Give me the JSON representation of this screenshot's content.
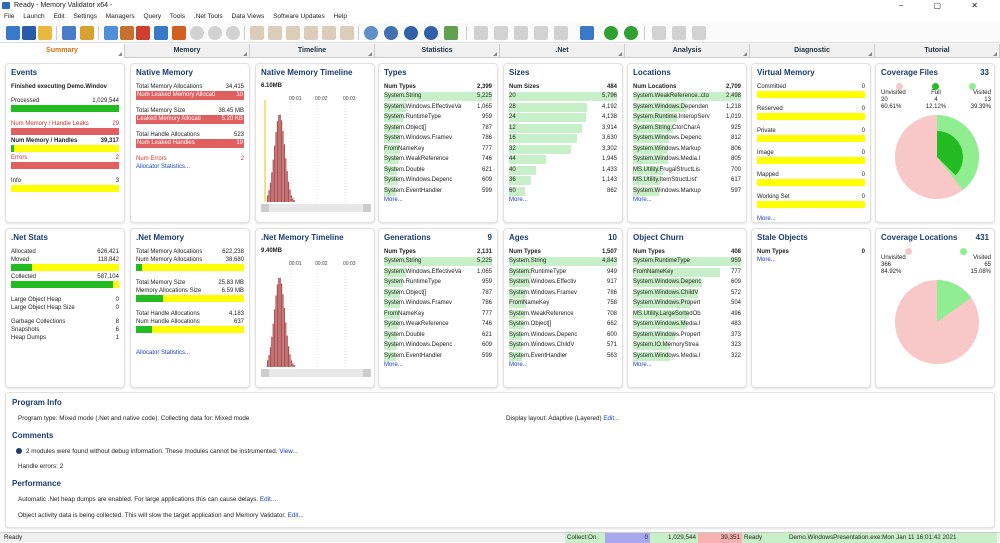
{
  "window": {
    "title": "Ready - Memory Validator x64 -",
    "controls": "–  ▢  ✕"
  },
  "menu": [
    "File",
    "Launch",
    "Edit",
    "Settings",
    "Managers",
    "Query",
    "Tools",
    ".Net Tools",
    "Data Views",
    "Software Updates",
    "Help"
  ],
  "tabs": [
    "Summary",
    "Memory",
    "Timeline",
    "Statistics",
    ".Net",
    "Analysis",
    "Diagnostic",
    "Tutorial"
  ],
  "colors": {
    "accent": "#d07010",
    "title": "#1a3d6e",
    "green": "#22bb22",
    "yellow": "#ffff00",
    "red": "#e06060",
    "lightgreen": "#c8f0c8",
    "pink": "#f8c8c8"
  },
  "events": {
    "title": "Events",
    "subtitle": "Finished executing Demo.Windov",
    "processed_label": "Processed",
    "processed": "1,029,544",
    "leaks_label": "Num Memory / Handle Leaks",
    "leaks": "29",
    "handles_label": "Num Memory / Handles",
    "handles": "39,317",
    "errors_label": "Errors",
    "errors": "2",
    "info_label": "Info",
    "info": "3"
  },
  "native_memory": {
    "title": "Native Memory",
    "total_alloc_label": "Total Memory Allocations",
    "total_alloc": "34,415",
    "leaked_alloc_label": "Num Leaked Memory Allocati",
    "leaked_alloc": "10",
    "total_size_label": "Total Memory Size",
    "total_size": "38.45 MB",
    "leaked_size_label": "Leaked Memory Allocati",
    "leaked_size": "5.20 KB",
    "handle_alloc_label": "Total Handle Allocations",
    "handle_alloc": "523",
    "leaked_handles_label": "Num Leaked Handles",
    "leaked_handles": "19",
    "errors_label": "Num Errors",
    "errors": "2",
    "link": "Allocator Statistics..."
  },
  "native_timeline": {
    "title": "Native Memory Timeline",
    "value": "6.10MB",
    "ticks": [
      "00:01",
      "00:02",
      "00:03"
    ]
  },
  "types": {
    "title": "Types",
    "header_name": "Num Types",
    "header_value": "2,399",
    "more": "More...",
    "rows": [
      [
        "System.String",
        "5,225",
        1
      ],
      [
        "System.Windows.EffectiveVa",
        "1,065",
        0.2
      ],
      [
        "System.RuntimeType",
        "959",
        0.18
      ],
      [
        "System.Object[]",
        "787",
        0.15
      ],
      [
        "System.Windows.Framev",
        "786",
        0.15
      ],
      [
        "FromNameKey",
        "777",
        0.15
      ],
      [
        "System.WeakReference",
        "746",
        0.14
      ],
      [
        "System.Double",
        "621",
        0.12
      ],
      [
        "System.Windows.Depenc",
        "609",
        0.12
      ],
      [
        "System.EventHandler",
        "599",
        0.11
      ]
    ]
  },
  "sizes": {
    "title": "Sizes",
    "header_name": "Num Sizes",
    "header_value": "484",
    "more": "More...",
    "rows": [
      [
        "20",
        "5,796",
        1
      ],
      [
        "28",
        "4,192",
        0.72
      ],
      [
        "24",
        "4,138",
        0.71
      ],
      [
        "12",
        "3,914",
        0.68
      ],
      [
        "16",
        "3,630",
        0.63
      ],
      [
        "32",
        "3,302",
        0.57
      ],
      [
        "44",
        "1,945",
        0.34
      ],
      [
        "40",
        "1,433",
        0.25
      ],
      [
        "36",
        "1,143",
        0.2
      ],
      [
        "60",
        "862",
        0.15
      ]
    ]
  },
  "locations": {
    "title": "Locations",
    "header_name": "Num Locations",
    "header_value": "2,709",
    "more": "More...",
    "rows": [
      [
        "System.WeakReference..cto",
        "2,498",
        1
      ],
      [
        "System.Windows.Dependen",
        "1,218",
        0.49
      ],
      [
        "System.Runtime.InteropServ",
        "1,019",
        0.41
      ],
      [
        "System.String.CtorCharA",
        "925",
        0.37
      ],
      [
        "System.Windows.Depenc",
        "812",
        0.33
      ],
      [
        "System.Windows.Markup",
        "806",
        0.32
      ],
      [
        "System.Windows.Media.I",
        "805",
        0.32
      ],
      [
        "MS.Utility.FrugalStructLis",
        "700",
        0.28
      ],
      [
        "MS.Utility.ItemStructList'",
        "617",
        0.25
      ],
      [
        "System.Windows.Markup",
        "597",
        0.24
      ]
    ]
  },
  "virtual_memory": {
    "title": "Virtual Memory",
    "more": "More...",
    "rows": [
      [
        "Committed",
        "0"
      ],
      [
        "Reserved",
        "0"
      ],
      [
        "Private",
        "0"
      ],
      [
        "Image",
        "0"
      ],
      [
        "Mapped",
        "0"
      ],
      [
        "Working Set",
        "0"
      ]
    ]
  },
  "coverage_files": {
    "title": "Coverage Files",
    "count": "33",
    "legend": [
      {
        "label": "Unvisited",
        "count": "20",
        "pct": "60.61%",
        "color": "#f8c8c8"
      },
      {
        "label": "Full",
        "count": "4",
        "pct": "12.12%",
        "color": "#22bb22"
      },
      {
        "label": "Visited",
        "count": "13",
        "pct": "39.39%",
        "color": "#90ee90"
      }
    ]
  },
  "net_stats": {
    "title": ".Net Stats",
    "allocated_label": "Allocated",
    "allocated": "626,421",
    "moved_label": "Moved",
    "moved": "118,842",
    "collected_label": "Collected",
    "collected": "587,104",
    "loh_label": "Large Object Heap",
    "loh": "0",
    "loh_size_label": "Large Object Heap Size",
    "loh_size": "0",
    "gc_label": "Garbage Collections",
    "gc": "8",
    "snap_label": "Snapshots",
    "snap": "6",
    "dumps_label": "Heap Dumps",
    "dumps": "1"
  },
  "net_memory": {
    "title": ".Net Memory",
    "total_alloc_label": "Total Memory Allocations",
    "total_alloc": "622,238",
    "num_alloc_label": "Num Memory Allocations",
    "num_alloc": "38,680",
    "total_size_label": "Total Memory Size",
    "total_size": "25.83 MB",
    "alloc_size_label": "Memory Allocations Size",
    "alloc_size": "6.59 MB",
    "handle_alloc_label": "Total Handle Allocations",
    "handle_alloc": "4,183",
    "num_handle_label": "Num Handle Allocations",
    "num_handle": "637",
    "link": "Allocator Statistics..."
  },
  "net_timeline": {
    "title": ".Net Memory Timeline",
    "value": "9.40MB",
    "ticks": [
      "00:01",
      "00:02",
      "00:03"
    ]
  },
  "generations": {
    "title": "Generations",
    "count": "9",
    "header_name": "Num Types",
    "header_value": "2,131",
    "more": "More...",
    "rows": [
      [
        "System.String",
        "5,225",
        1
      ],
      [
        "System.Windows.EffectiveVa",
        "1,065",
        0.2
      ],
      [
        "System.RuntimeType",
        "959",
        0.18
      ],
      [
        "System.Object[]",
        "787",
        0.15
      ],
      [
        "System.Windows.Framev",
        "786",
        0.15
      ],
      [
        "FromNameKey",
        "777",
        0.15
      ],
      [
        "System.WeakReference",
        "746",
        0.14
      ],
      [
        "System.Double",
        "621",
        0.12
      ],
      [
        "System.Windows.Depenc",
        "609",
        0.12
      ],
      [
        "System.EventHandler",
        "599",
        0.11
      ]
    ]
  },
  "ages": {
    "title": "Ages",
    "count": "10",
    "header_name": "Num Types",
    "header_value": "1,507",
    "more": "More...",
    "rows": [
      [
        "System.String",
        "4,843",
        1
      ],
      [
        "System.RuntimeType",
        "949",
        0.2
      ],
      [
        "System.Windows.Effectiv",
        "917",
        0.19
      ],
      [
        "System.Windows.Framev",
        "786",
        0.16
      ],
      [
        "FromNameKey",
        "758",
        0.16
      ],
      [
        "System.WeakReference",
        "708",
        0.15
      ],
      [
        "System.Object[]",
        "662",
        0.14
      ],
      [
        "System.Windows.Depenc",
        "600",
        0.12
      ],
      [
        "System.Windows.ChildV",
        "571",
        0.12
      ],
      [
        "System.EventHandler",
        "563",
        0.12
      ]
    ]
  },
  "object_churn": {
    "title": "Object Churn",
    "header_name": "Num Types",
    "header_value": "408",
    "more": "More...",
    "rows": [
      [
        "System.RuntimeType",
        "959",
        1
      ],
      [
        "FromNameKey",
        "777",
        0.81
      ],
      [
        "System.Windows.Depenc",
        "609",
        0.64
      ],
      [
        "System.Windows.ChildV",
        "572",
        0.6
      ],
      [
        "System.Windows.Propert",
        "504",
        0.53
      ],
      [
        "MS.Utility.LargeSortedOb",
        "496",
        0.52
      ],
      [
        "System.Windows.Media.I",
        "483",
        0.5
      ],
      [
        "System.Windows.Propert",
        "373",
        0.39
      ],
      [
        "System.IO.MemoryStrea",
        "323",
        0.34
      ],
      [
        "System.Windows.Media.I",
        "322",
        0.34
      ]
    ]
  },
  "stale_objects": {
    "title": "Stale Objects",
    "header_name": "Num Types",
    "header_value": "0",
    "more": "More..."
  },
  "coverage_locations": {
    "title": "Coverage Locations",
    "count": "431",
    "legend": [
      {
        "label": "Unvisited",
        "count": "366",
        "pct": "84.92%",
        "color": "#f8c8c8"
      },
      {
        "label": "Visited",
        "count": "65",
        "pct": "15.08%",
        "color": "#90ee90"
      }
    ]
  },
  "program_info": {
    "title": "Program Info",
    "text": "Program type: Mixed mode (.Net and native code). Collecting data for: Mixed mode",
    "layout_text": "Display layout: Adaptive (Layered)",
    "layout_link": "Edit..."
  },
  "comments": {
    "title": "Comments",
    "text": "2 modules were found without debug information. These modules cannot be instrumented.",
    "link": "View...",
    "handle_errors": "Handle errors: 2"
  },
  "performance": {
    "title": "Performance",
    "line1": "Automatic .Net heap dumps are enabled. For large applications this can cause delays.",
    "line1_link": "Edit...",
    "line2": "Object activity data is being collected. This will slow the target application and Memory Validator.",
    "line2_link": "Edit..."
  },
  "status": {
    "left": "Ready",
    "collect": "Collect:On",
    "n0": "0",
    "n1": "1,029,544",
    "n2": "39,351",
    "ready": "Ready",
    "info": "Demo.WindowsPresentation.exe:Mon Jan 11 16:01:42 2021"
  }
}
